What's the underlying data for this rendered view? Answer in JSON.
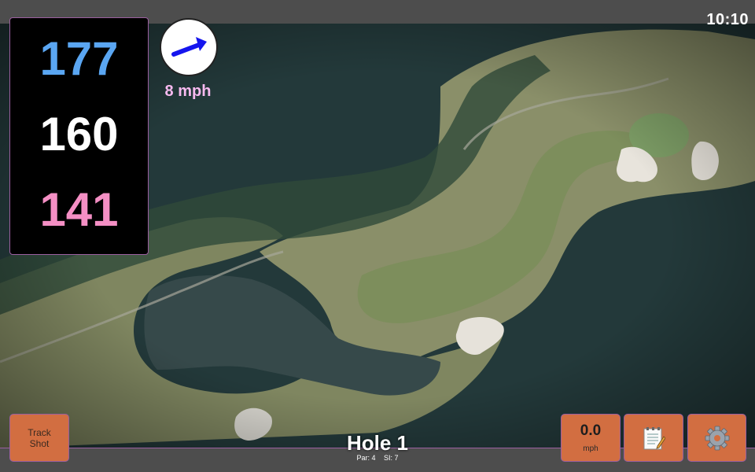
{
  "status": {
    "time": "10:10"
  },
  "distances": {
    "back": "177",
    "middle": "160",
    "front": "141"
  },
  "wind": {
    "speed": "8 mph",
    "direction_icon": "wind-arrow-icon"
  },
  "hole": {
    "title": "Hole 1",
    "par": "Par: 4",
    "stroke_index": "SI: 7"
  },
  "buttons": {
    "track_shot": {
      "line1": "Track",
      "line2": "Shot"
    },
    "speed": {
      "value": "0.0",
      "unit": "mph"
    },
    "notes_icon": "notepad-icon",
    "settings_icon": "gear-icon"
  },
  "colors": {
    "back_distance": "#5aa6f2",
    "middle_distance": "#ffffff",
    "front_distance": "#f48fc4",
    "wind_text": "#f7b9ef",
    "button_fill": "#d26e41",
    "accent_border": "#9b5fa0"
  }
}
